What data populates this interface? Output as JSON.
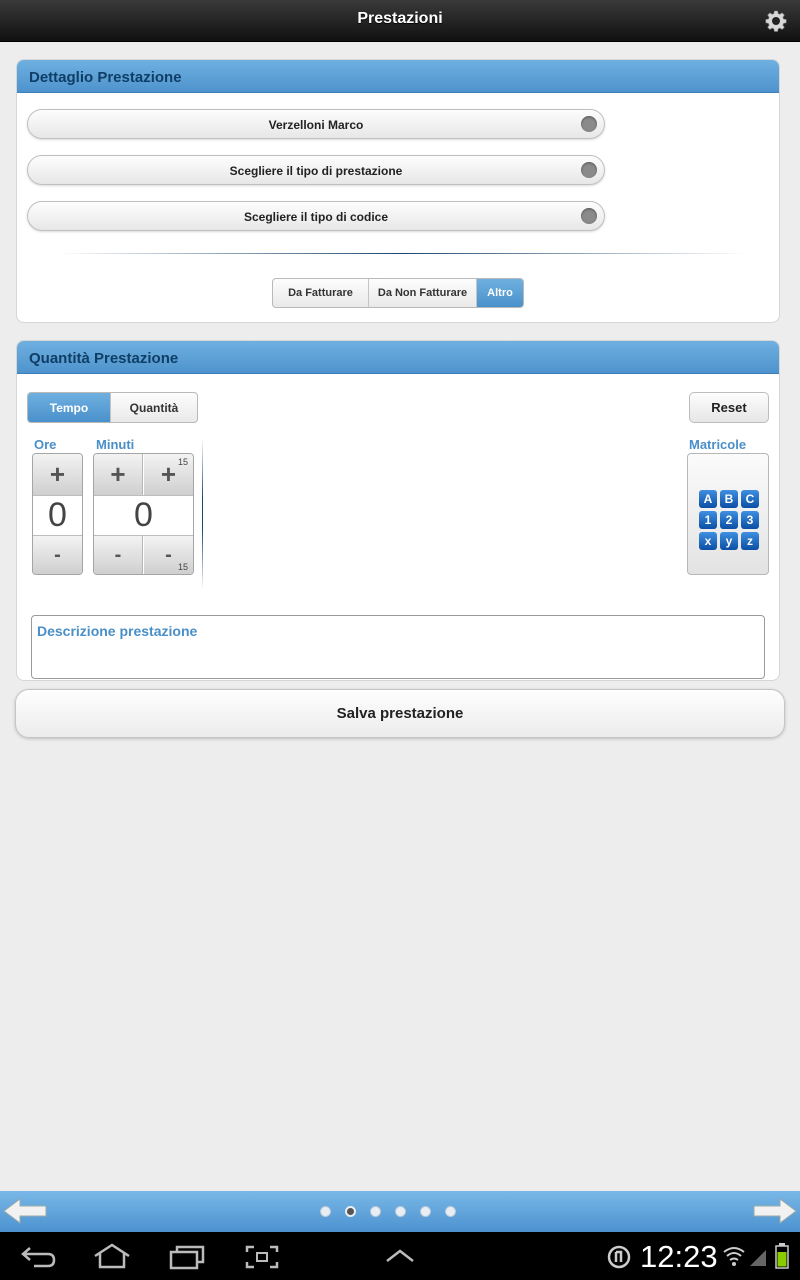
{
  "header": {
    "title": "Prestazioni",
    "settings_icon": "gear-icon"
  },
  "detail_panel": {
    "title": "Dettaglio Prestazione",
    "selects": [
      {
        "label": "Verzelloni Marco"
      },
      {
        "label": "Scegliere il tipo di prestazione"
      },
      {
        "label": "Scegliere il tipo di codice"
      }
    ],
    "billing_segments": [
      {
        "label": "Da Fatturare",
        "active": false
      },
      {
        "label": "Da Non Fatturare",
        "active": false
      },
      {
        "label": "Altro",
        "active": true
      }
    ]
  },
  "quantity_panel": {
    "title": "Quantità Prestazione",
    "mode_segments": [
      {
        "label": "Tempo",
        "active": true
      },
      {
        "label": "Quantità",
        "active": false
      }
    ],
    "reset_label": "Reset",
    "hours": {
      "label": "Ore",
      "value": "0",
      "plus": "+",
      "minus": "-"
    },
    "minutes": {
      "label": "Minuti",
      "value": "0",
      "plus": "+",
      "minus": "-",
      "step": "15"
    },
    "matricole": {
      "label": "Matricole",
      "keys": [
        "A",
        "B",
        "C",
        "1",
        "2",
        "3",
        "x",
        "y",
        "z"
      ]
    },
    "description_placeholder": "Descrizione prestazione"
  },
  "save_label": "Salva prestazione",
  "pager": {
    "pages": 6,
    "active_index": 1
  },
  "system_bar": {
    "time": "12:23"
  },
  "colors": {
    "accent": "#4e93cd",
    "header_text": "#0f3e66",
    "label_blue": "#4a8fc8"
  }
}
